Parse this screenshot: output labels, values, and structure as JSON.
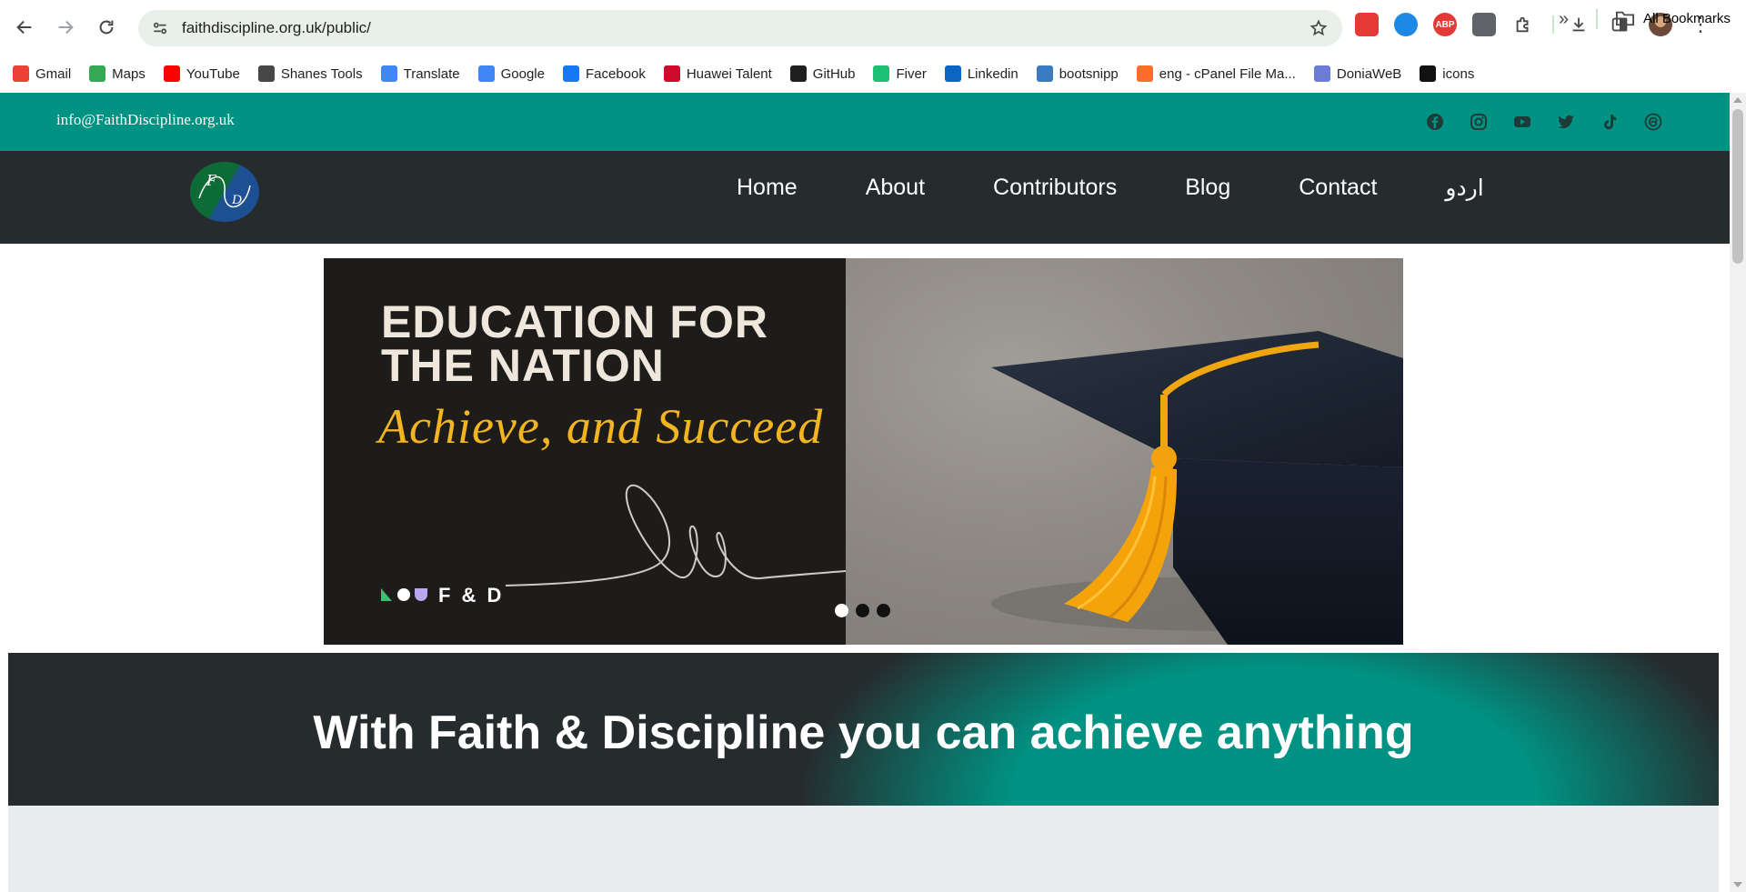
{
  "browser": {
    "url": "faithdiscipline.org.uk/public/",
    "bookmarks": [
      {
        "label": "Gmail",
        "icon": "gmail-icon",
        "color": "#ea4335"
      },
      {
        "label": "Maps",
        "icon": "maps-icon",
        "color": "#34a853"
      },
      {
        "label": "YouTube",
        "icon": "youtube-icon",
        "color": "#ff0000"
      },
      {
        "label": "Shanes Tools",
        "icon": "globe-icon",
        "color": "#474747"
      },
      {
        "label": "Translate",
        "icon": "translate-icon",
        "color": "#4285f4"
      },
      {
        "label": "Google",
        "icon": "google-icon",
        "color": "#4285f4"
      },
      {
        "label": "Facebook",
        "icon": "facebook-icon",
        "color": "#1877f2"
      },
      {
        "label": "Huawei Talent",
        "icon": "huawei-icon",
        "color": "#cf0a2c"
      },
      {
        "label": "GitHub",
        "icon": "github-icon",
        "color": "#1f1f1f"
      },
      {
        "label": "Fiver",
        "icon": "fiverr-icon",
        "color": "#1dbf73"
      },
      {
        "label": "Linkedin",
        "icon": "linkedin-icon",
        "color": "#0a66c2"
      },
      {
        "label": "bootsnipp",
        "icon": "bootsnipp-icon",
        "color": "#3b7bbf"
      },
      {
        "label": "eng - cPanel File Ma...",
        "icon": "cpanel-icon",
        "color": "#ff6c2c"
      },
      {
        "label": "DoniaWeB",
        "icon": "doniaweb-icon",
        "color": "#6b7bd6"
      },
      {
        "label": "icons",
        "icon": "icons-icon",
        "color": "#111111"
      }
    ],
    "all_bookmarks": "All Bookmarks",
    "extensions": [
      {
        "label": "",
        "icon": "extension-red-icon",
        "color": "#e53935"
      },
      {
        "label": "",
        "icon": "download-manager-icon",
        "color": "#1e88e5"
      },
      {
        "label": "ABP",
        "icon": "adblock-icon",
        "color": "#e53935"
      },
      {
        "label": "",
        "icon": "robot-icon",
        "color": "#5f6368"
      }
    ]
  },
  "site": {
    "email": "info@FaithDiscipline.org.uk",
    "socials": [
      "facebook-icon",
      "instagram-icon",
      "youtube-icon",
      "twitter-icon",
      "tiktok-icon",
      "threads-icon"
    ],
    "logo": {
      "letter1": "F",
      "letter2": "D"
    },
    "nav": [
      "Home",
      "About",
      "Contributors",
      "Blog",
      "Contact",
      "اردو"
    ],
    "slide": {
      "line1": "EDUCATION FOR",
      "line2": "THE NATION",
      "script": "Achieve, and Succeed",
      "brand": "F & D"
    },
    "slider_dots": 3,
    "active_slide": 1,
    "banner_text": "With Faith & Discipline you can achieve anything"
  }
}
